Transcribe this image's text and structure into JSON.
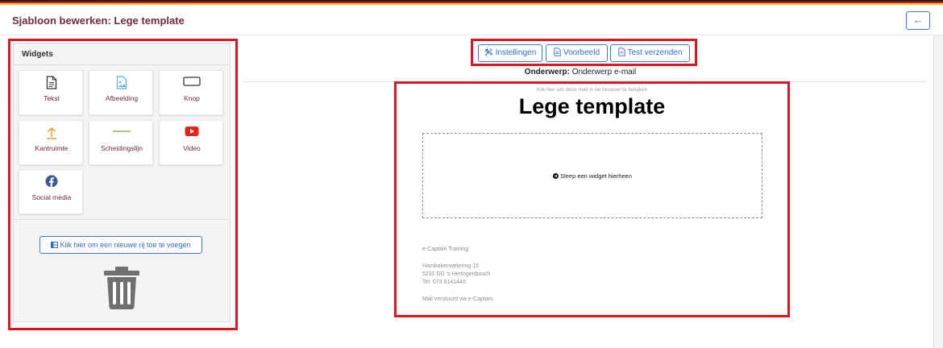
{
  "header": {
    "title": "Sjabloon bewerken: Lege template",
    "back_icon": "arrow-left-icon",
    "back_label": "←"
  },
  "widgets": {
    "title": "Widgets",
    "items": [
      {
        "label": "Tekst",
        "icon": "document-text-icon",
        "color": "#333333"
      },
      {
        "label": "Afbeelding",
        "icon": "image-icon",
        "color": "#5aaee8"
      },
      {
        "label": "Knop",
        "icon": "button-icon",
        "color": "#333333"
      },
      {
        "label": "Kantruimte",
        "icon": "arrow-up-icon",
        "color": "#f0961e"
      },
      {
        "label": "Scheidingslijn",
        "icon": "divider-line-icon",
        "color": "#8cb84e"
      },
      {
        "label": "Video",
        "icon": "youtube-icon",
        "color": "#e62117"
      },
      {
        "label": "Social media",
        "icon": "facebook-icon",
        "color": "#3b5998"
      }
    ],
    "add_row_label": "Klik hier om een nieuwe rij toe te voegen",
    "trash_icon": "trash-icon"
  },
  "toolbar": {
    "buttons": [
      {
        "label": "Instellingen",
        "icon": "tools-icon"
      },
      {
        "label": "Voorbeeld",
        "icon": "document-icon"
      },
      {
        "label": "Test verzenden",
        "icon": "document-send-icon"
      }
    ]
  },
  "subject": {
    "label": "Onderwerp:",
    "value": "Onderwerp e-mail"
  },
  "email": {
    "browser_link": "Klik hier om deze mail in de browser te bekijken",
    "title": "Lege template",
    "dropzone_text": "Sleep een widget hierheen",
    "footer": {
      "company": "e-Captain Training",
      "street": "Hambakenwetering 15",
      "city": "5231 DD 's-Hertogenbosch",
      "phone": "Tel: 073 6141440",
      "sent_via": "Mail verstuurd via e-Captain"
    }
  },
  "colors": {
    "accent": "#3a7bd5",
    "title": "#6b2c3f",
    "highlight": "#e0141f"
  }
}
